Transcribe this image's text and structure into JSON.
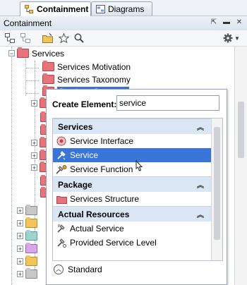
{
  "tabs": [
    {
      "label": "Containment",
      "active": true,
      "icon": "containment-tree-icon"
    },
    {
      "label": "Diagrams",
      "active": false,
      "icon": "diagrams-icon"
    }
  ],
  "panel": {
    "title": "Containment",
    "buttons": [
      "float-icon",
      "minimize-icon",
      "close-icon"
    ]
  },
  "toolbar": {
    "icons": [
      "collapse-all-icon",
      "expand-all-icon",
      "open-folder-icon",
      "star-icon",
      "search-icon",
      "gear-icon"
    ]
  },
  "tree": {
    "services_label": "Services",
    "children": [
      {
        "label": "Services Motivation"
      },
      {
        "label": "Services Taxonomy"
      },
      {
        "label": "Services Structure",
        "selected": true
      }
    ]
  },
  "popup": {
    "create_label": "Create Element:",
    "search_value": "service",
    "groups": [
      {
        "label": "Services",
        "items": [
          {
            "label": "Service Interface",
            "icon": "service-interface-icon"
          },
          {
            "label": "Service",
            "icon": "service-icon",
            "selected": true
          },
          {
            "label": "Service Function",
            "icon": "service-function-icon"
          }
        ]
      },
      {
        "label": "Package",
        "items": [
          {
            "label": "Services Structure",
            "icon": "package-icon"
          }
        ]
      },
      {
        "label": "Actual Resources",
        "items": [
          {
            "label": "Actual Service",
            "icon": "actual-service-icon"
          },
          {
            "label": "Provided Service Level",
            "icon": "provided-service-level-icon"
          }
        ]
      }
    ],
    "mode_label": "Standard"
  },
  "colors": {
    "selection": "#3875d7",
    "group_header": "#dbe6f5"
  }
}
